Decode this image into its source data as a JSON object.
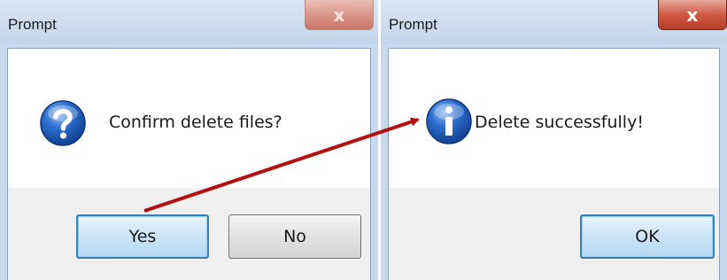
{
  "dialogs": [
    {
      "title": "Prompt",
      "message": "Confirm delete files?",
      "icon": "question-icon",
      "buttons": {
        "yes": "Yes",
        "no": "No"
      },
      "close": "x"
    },
    {
      "title": "Prompt",
      "message": "Delete successfully!",
      "icon": "info-icon",
      "buttons": {
        "ok": "OK"
      },
      "close": "x"
    }
  ],
  "colors": {
    "frame": "#c9d9ec",
    "close_active": "#c53f28",
    "close_inactive": "#d89284",
    "icon_blue": "#1f57b8",
    "arrow": "#b01010",
    "default_button_border": "#3c7fb1"
  }
}
